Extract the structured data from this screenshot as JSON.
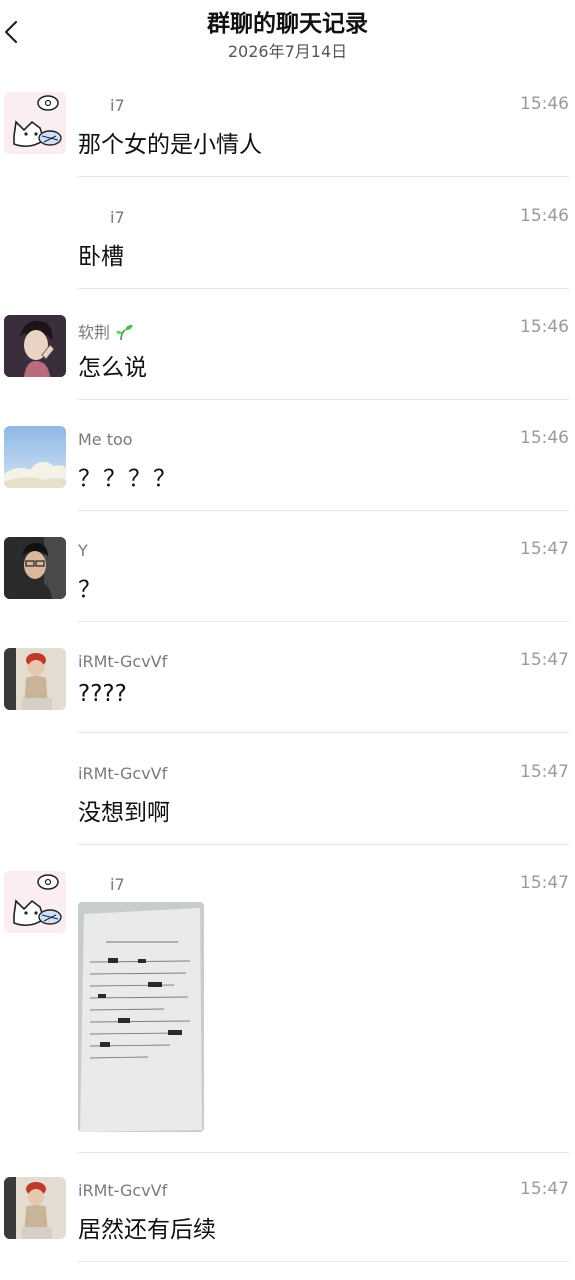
{
  "header": {
    "title": "群聊的聊天记录",
    "date": "2026年7月14日"
  },
  "messages": [
    {
      "sender": "i7",
      "time": "15:46",
      "text": "那个女的是小情人"
    },
    {
      "sender": "i7",
      "time": "15:46",
      "text": "卧槽"
    },
    {
      "sender": "软荆",
      "time": "15:46",
      "text": "怎么说"
    },
    {
      "sender": "Me too",
      "time": "15:46",
      "text": "？？？？"
    },
    {
      "sender": "Y",
      "time": "15:47",
      "text": "？"
    },
    {
      "sender": "iRMt-GcvVf",
      "time": "15:47",
      "text": "????"
    },
    {
      "sender": "iRMt-GcvVf",
      "time": "15:47",
      "text": "没想到啊"
    },
    {
      "sender": "i7",
      "time": "15:47",
      "image": "handwritten-document-photo"
    },
    {
      "sender": "iRMt-GcvVf",
      "time": "15:47",
      "text": "居然还有后续"
    }
  ],
  "colors": {
    "background": "#ffffff",
    "sender_text": "#7a7a7a",
    "time_text": "#9a9a9a",
    "divider": "#e5e5e5"
  }
}
